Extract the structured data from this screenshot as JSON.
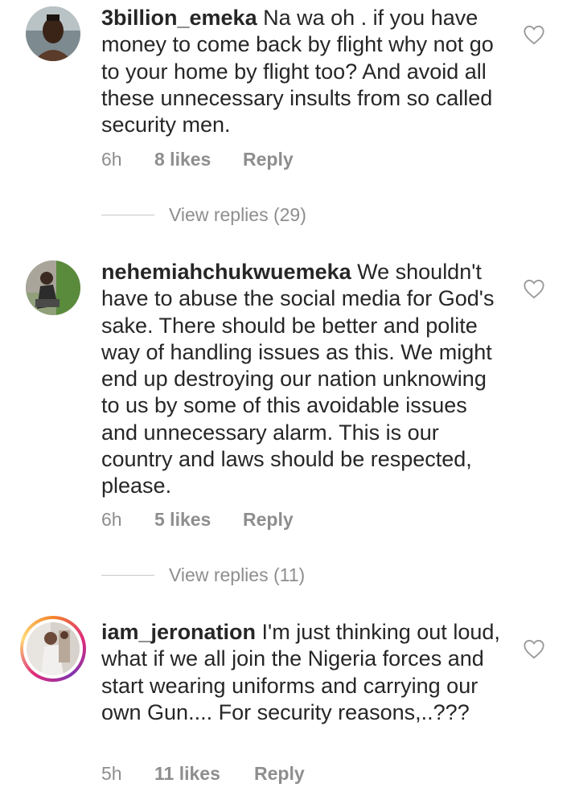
{
  "comments": [
    {
      "username": "3billion_emeka",
      "text": " Na wa oh . if you have money to come back by flight why not go to your home by flight too? And avoid all these unnecessary insults from so called security men.",
      "time": "6h",
      "likes": "8 likes",
      "reply": "Reply",
      "view_replies": "View replies (29)"
    },
    {
      "username": "nehemiahchukwuemeka",
      "text": " We shouldn't have to abuse the social media for God's sake. There should be better and polite way of handling issues as this. We might end up destroying our nation unknowing to us by some of this avoidable issues and unnecessary alarm. This is our country and laws should be respected, please.",
      "time": "6h",
      "likes": "5 likes",
      "reply": "Reply",
      "view_replies": "View replies (11)"
    },
    {
      "username": "iam_jeronation",
      "text": " I'm just thinking out loud, what if we all join the Nigeria forces and start wearing uniforms and carrying our own Gun.... For security reasons,..???",
      "time": "5h",
      "likes": "11 likes",
      "reply": "Reply"
    }
  ],
  "icons": {
    "like": "heart-outline-icon"
  },
  "colors": {
    "text": "#262626",
    "secondary": "#8e8e8e",
    "story_ring": "#dd2a7b"
  }
}
